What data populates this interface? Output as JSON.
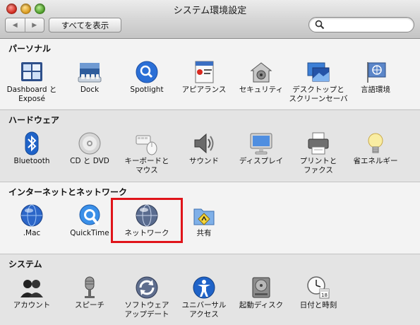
{
  "window": {
    "title": "システム環境設定",
    "back_label": "◀",
    "forward_label": "▶",
    "show_all_label": "すべてを表示",
    "search_value": "",
    "search_placeholder": ""
  },
  "sections": {
    "personal": {
      "title": "パーソナル",
      "items": [
        {
          "label": "Dashboard と\nExposé",
          "icon": "dashboard-icon"
        },
        {
          "label": "Dock",
          "icon": "dock-icon"
        },
        {
          "label": "Spotlight",
          "icon": "spotlight-icon"
        },
        {
          "label": "アピアランス",
          "icon": "appearance-icon"
        },
        {
          "label": "セキュリティ",
          "icon": "security-icon"
        },
        {
          "label": "デスクトップと\nスクリーンセーバ",
          "icon": "desktop-icon"
        },
        {
          "label": "言語環境",
          "icon": "language-icon"
        }
      ]
    },
    "hardware": {
      "title": "ハードウェア",
      "items": [
        {
          "label": "Bluetooth",
          "icon": "bluetooth-icon"
        },
        {
          "label": "CD と DVD",
          "icon": "cd-dvd-icon"
        },
        {
          "label": "キーボードと\nマウス",
          "icon": "keyboard-mouse-icon"
        },
        {
          "label": "サウンド",
          "icon": "sound-icon"
        },
        {
          "label": "ディスプレイ",
          "icon": "display-icon"
        },
        {
          "label": "プリントと\nファクス",
          "icon": "printer-icon"
        },
        {
          "label": "省エネルギー",
          "icon": "energy-saver-icon"
        }
      ]
    },
    "internet": {
      "title": "インターネットとネットワーク",
      "items": [
        {
          "label": ".Mac",
          "icon": "dotmac-icon"
        },
        {
          "label": "QuickTime",
          "icon": "quicktime-icon"
        },
        {
          "label": "ネットワーク",
          "icon": "network-icon"
        },
        {
          "label": "共有",
          "icon": "sharing-icon"
        }
      ]
    },
    "system": {
      "title": "システム",
      "items": [
        {
          "label": "アカウント",
          "icon": "accounts-icon"
        },
        {
          "label": "スピーチ",
          "icon": "speech-icon"
        },
        {
          "label": "ソフトウェア\nアップデート",
          "icon": "software-update-icon"
        },
        {
          "label": "ユニバーサル\nアクセス",
          "icon": "universal-access-icon"
        },
        {
          "label": "起動ディスク",
          "icon": "startup-disk-icon"
        },
        {
          "label": "日付と時刻",
          "icon": "date-time-icon"
        }
      ]
    }
  },
  "colors": {
    "highlight": "#e0141a",
    "spotlight": "#2b6fd6"
  }
}
